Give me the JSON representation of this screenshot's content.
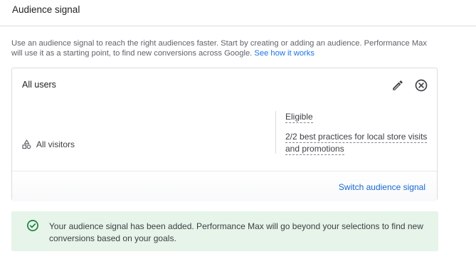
{
  "header": {
    "title": "Audience signal"
  },
  "description": {
    "text": "Use an audience signal to reach the right audiences faster. Start by creating or adding an audience. Performance Max will use it as a starting point, to find new conversions across Google.",
    "link": "See how it works"
  },
  "card": {
    "title": "All users",
    "segment_label": "All visitors",
    "status": "Eligible",
    "practices": "2/2 best practices for local store visits and promotions",
    "switch_label": "Switch audience signal"
  },
  "banner": {
    "message": "Your audience signal has been added. Performance Max will go beyond your selections to find new conversions based on your goals."
  },
  "colors": {
    "link": "#1a73e8",
    "success_bg": "#e6f4ea",
    "success_icon": "#188038"
  },
  "icons": [
    "edit-icon",
    "remove-icon",
    "audience-segment-icon",
    "check-circle-icon"
  ]
}
